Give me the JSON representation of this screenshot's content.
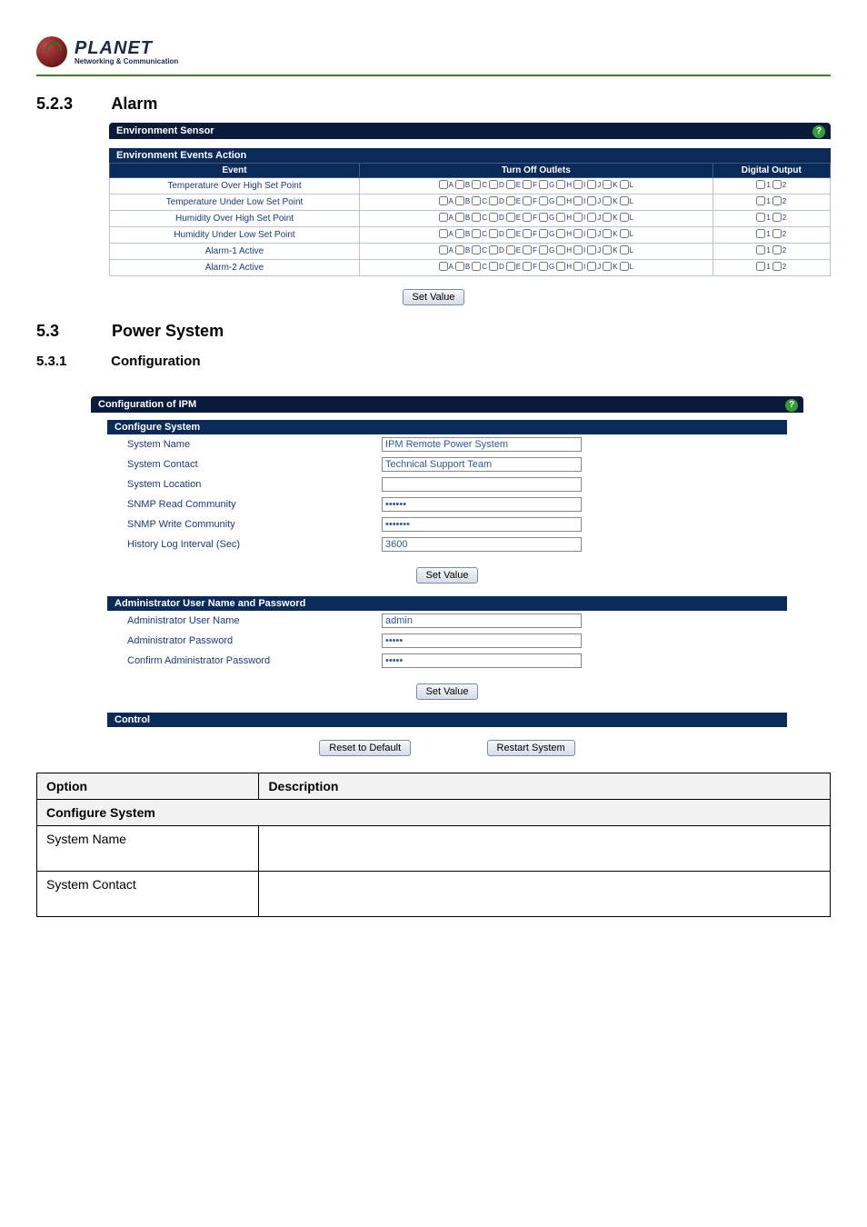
{
  "logo": {
    "name": "PLANET",
    "tag": "Networking & Communication"
  },
  "sec_5_2_3": {
    "num": "5.2.3",
    "title": "Alarm"
  },
  "sec_5_3": {
    "num": "5.3",
    "title": "Power System"
  },
  "sec_5_3_1": {
    "num": "5.3.1",
    "title": "Configuration"
  },
  "env": {
    "panel_title": "Environment Sensor",
    "sub_title": "Environment Events Action",
    "col_event": "Event",
    "col_turnoff": "Turn Off Outlets",
    "col_digout": "Digital Output",
    "letters": [
      "A",
      "B",
      "C",
      "D",
      "E",
      "F",
      "G",
      "H",
      "I",
      "J",
      "K",
      "L"
    ],
    "digits": [
      "1",
      "2"
    ],
    "events": [
      "Temperature Over High Set Point",
      "Temperature Under Low Set Point",
      "Humidity Over High Set Point",
      "Humidity Under Low Set Point",
      "Alarm-1 Active",
      "Alarm-2 Active"
    ],
    "set_value": "Set Value"
  },
  "cfg": {
    "panel_title": "Configuration of IPM",
    "sec_cfg": "Configure System",
    "rows": {
      "sys_name": {
        "label": "System Name",
        "value": "IPM Remote Power System"
      },
      "sys_contact": {
        "label": "System Contact",
        "value": "Technical Support Team"
      },
      "sys_location": {
        "label": "System Location",
        "value": ""
      },
      "snmp_read": {
        "label": "SNMP Read Community",
        "value": "••••••"
      },
      "snmp_write": {
        "label": "SNMP Write Community",
        "value": "•••••••"
      },
      "hist": {
        "label": "History Log Interval (Sec)",
        "value": "3600"
      }
    },
    "set_value": "Set Value",
    "sec_admin": "Administrator User Name and Password",
    "admin": {
      "user": {
        "label": "Administrator User Name",
        "value": "admin"
      },
      "pass": {
        "label": "Administrator Password",
        "value": "•••••"
      },
      "conf": {
        "label": "Confirm Administrator Password",
        "value": "•••••"
      }
    },
    "sec_ctrl": "Control",
    "reset": "Reset to Default",
    "restart": "Restart System"
  },
  "opt": {
    "h_option": "Option",
    "h_desc": "Description",
    "h_cfg": "Configure System",
    "r_sysname": "System Name",
    "r_syscontact": "System Contact"
  }
}
